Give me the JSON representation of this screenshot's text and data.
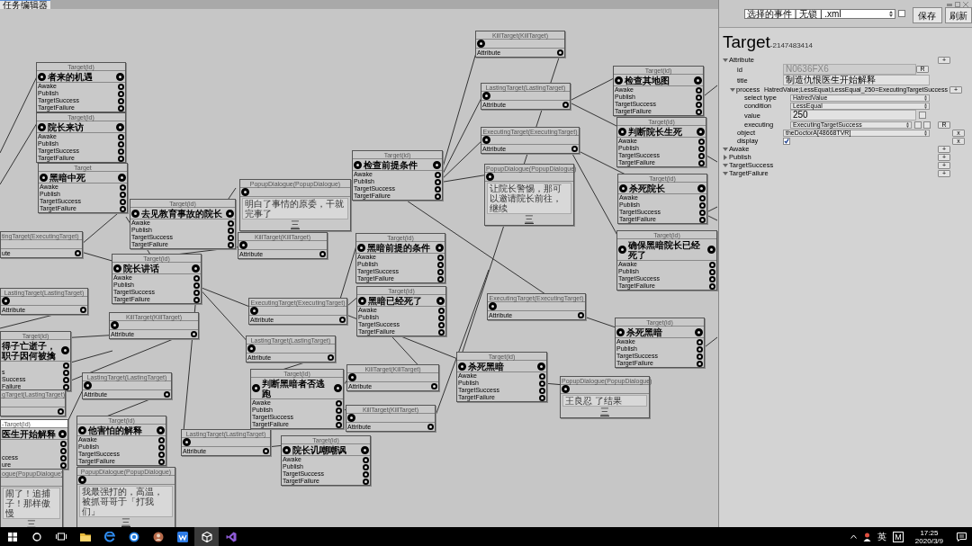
{
  "window": {
    "tab": "任务编辑器"
  },
  "nodes": [
    {
      "kind": "target",
      "header": "Target(id)",
      "title": "者来的机遇",
      "rows": [
        "Awake",
        "Publish",
        "TargetSuccess",
        "TargetFailure"
      ],
      "selected": false
    },
    {
      "kind": "target",
      "header": "Target(id)",
      "title": "院长来访",
      "rows": [
        "Awake",
        "Publish",
        "TargetSuccess",
        "TargetFailure"
      ],
      "selected": false
    },
    {
      "kind": "target",
      "header": "Target",
      "title": "黑暗中死",
      "rows": [
        "Awake",
        "Publish",
        "TargetSuccess",
        "TargetFailure"
      ],
      "selected": false
    },
    {
      "kind": "target",
      "header": "Target(id)",
      "title": "去见教育事故的院长",
      "rows": [
        "Awake",
        "Publish",
        "TargetSuccess",
        "TargetFailure"
      ],
      "selected": false
    },
    {
      "kind": "popup",
      "header": "PopupDialogue(PopupDialogue)",
      "text": "明白了事情的原委，干就完事了",
      "button": "三",
      "selected": false
    },
    {
      "kind": "single",
      "header": "tingTarget(ExecutingTarget)",
      "label": "ute",
      "selected": false
    },
    {
      "kind": "single",
      "header": "KillTarget(KillTarget)",
      "label": "Attribute",
      "selected": false
    },
    {
      "kind": "target",
      "header": "Target(id)",
      "title": "院长讲话",
      "rows": [
        "Awake",
        "Publish",
        "TargetSuccess",
        "TargetFailure"
      ],
      "selected": false
    },
    {
      "kind": "single",
      "header": "LastingTarget(LastingTarget)",
      "label": "Attribute",
      "selected": false
    },
    {
      "kind": "single",
      "header": "KillTarget(KillTarget)",
      "label": "Attribute",
      "selected": false
    },
    {
      "kind": "target",
      "header": "Target(id)",
      "title": "得子亡逝子，职子因何被擒",
      "rows": [
        "s",
        "Success",
        "Failure"
      ],
      "selected": false
    },
    {
      "kind": "single",
      "header": "gTarget(LastingTarget)",
      "selected": false
    },
    {
      "kind": "target",
      "header": "-Target(id)",
      "title": "医生开始解释",
      "rows": [
        "ccess",
        "ure"
      ],
      "selected": true
    },
    {
      "kind": "popup",
      "header": "ogue(PopupDialogue)",
      "text": "闹了！追捕子！那样傲慢",
      "button": "三",
      "selected": false
    },
    {
      "kind": "single",
      "header": "LastingTarget(LastingTarget)",
      "label": "Attribute",
      "selected": false
    },
    {
      "kind": "target",
      "header": "Target(id)",
      "title": "他害怕的解释",
      "rows": [
        "Awake",
        "Publish",
        "TargetSuccess",
        "TargetFailure"
      ],
      "selected": false
    },
    {
      "kind": "popup",
      "header": "PopupDialogue(PopupDialogue)",
      "text": "我最强打的，高温，被抓哥哥于「打我们」",
      "button": "三",
      "selected": false
    },
    {
      "kind": "single",
      "header": "LastingTarget(LastingTarget)",
      "label": "Attribute",
      "selected": false
    },
    {
      "kind": "single",
      "header": "ExecutingTarget(ExecutingTarget)",
      "label": "Attribute",
      "selected": false
    },
    {
      "kind": "single",
      "header": "LastingTarget(LastingTarget)",
      "label": "Attribute",
      "selected": false
    },
    {
      "kind": "target",
      "header": "Target(id)",
      "title": "判断黑暗者否逃跑",
      "rows": [
        "Awake",
        "Publish",
        "TargetSuccess",
        "TargetFailure"
      ],
      "selected": false
    },
    {
      "kind": "single",
      "header": "KillTarget(KillTarget)",
      "label": "Attribute",
      "selected": false
    },
    {
      "kind": "single",
      "header": "KillTarget(KillTarget)",
      "label": "Attribute",
      "selected": false
    },
    {
      "kind": "target",
      "header": "Target(id)",
      "title": "院长讥嘲嘲讽",
      "rows": [
        "Awake",
        "Publish",
        "TargetSuccess",
        "TargetFailure"
      ],
      "selected": false
    },
    {
      "kind": "target",
      "header": "Target(id)",
      "title": "检查前提条件",
      "rows": [
        "Awake",
        "Publish",
        "TargetSuccess",
        "TargetFailure"
      ],
      "selected": false
    },
    {
      "kind": "target",
      "header": "Target(id)",
      "title": "黑暗前提的条件",
      "rows": [
        "Awake",
        "Publish",
        "TargetSuccess",
        "TargetFailure"
      ],
      "selected": false
    },
    {
      "kind": "target",
      "header": "Target(id)",
      "title": "黑暗已经死了",
      "rows": [
        "Awake",
        "Publish",
        "TargetSuccess",
        "TargetFailure"
      ],
      "selected": false
    },
    {
      "kind": "single",
      "header": "KillTarget(KillTarget)",
      "label": "Attribute",
      "selected": false
    },
    {
      "kind": "single",
      "header": "LastingTarget(LastingTarget)",
      "label": "Attribute",
      "selected": false
    },
    {
      "kind": "single",
      "header": "ExecutingTarget(ExecutingTarget)",
      "label": "Attribute",
      "selected": false
    },
    {
      "kind": "popup",
      "header": "PopupDialogue(PopupDialogue)",
      "text": "让院长警惕，那可以邀请院长前往，继续",
      "button": "三",
      "selected": false
    },
    {
      "kind": "single",
      "header": "ExecutingTarget(ExecutingTarget)",
      "label": "Attribute",
      "selected": false
    },
    {
      "kind": "target",
      "header": "Target(id)",
      "title": "杀死黑暗",
      "rows": [
        "Awake",
        "Publish",
        "TargetSuccess",
        "TargetFailure"
      ],
      "selected": false
    },
    {
      "kind": "popup",
      "header": "PopupDialogue(PopupDialogue)",
      "text": "王良忍 了结果",
      "button": "三",
      "selected": false
    },
    {
      "kind": "target",
      "header": "Target(id)",
      "title": "检查其地图",
      "rows": [
        "Awake",
        "Publish",
        "TargetSuccess",
        "TargetFailure"
      ],
      "selected": false
    },
    {
      "kind": "target",
      "header": "Target(id)",
      "title": "判断院长生死",
      "rows": [
        "Awake",
        "Publish",
        "TargetSuccess",
        "TargetFailure"
      ],
      "selected": false
    },
    {
      "kind": "target",
      "header": "Target(id)",
      "title": "杀死院长",
      "rows": [
        "Awake",
        "Publish",
        "TargetSuccess",
        "TargetFailure"
      ],
      "selected": false
    },
    {
      "kind": "target",
      "header": "Target(id)",
      "title": "确保黑暗院长已经死了",
      "rows": [
        "Awake",
        "Publish",
        "TargetSuccess",
        "TargetFailure"
      ],
      "selected": false
    },
    {
      "kind": "target",
      "header": "Target(id)",
      "title": "杀死黑暗",
      "rows": [
        "Awake",
        "Publish",
        "TargetSuccess",
        "TargetFailure"
      ],
      "selected": false
    }
  ],
  "toolbar": {
    "file_dropdown": "选择的事件 | 无锁 | .xml",
    "checkbox": {
      "checked": false
    },
    "buttons": [
      "保存",
      "刷新"
    ]
  },
  "inspector": {
    "heading": "Target",
    "number": "-2147483414",
    "sections": [
      {
        "label": "Attribute",
        "expanded": true,
        "button": "+",
        "fields": [
          {
            "kind": "text",
            "label": "id",
            "value": "N0636FX6",
            "disabled": true,
            "button": "R"
          },
          {
            "kind": "text",
            "label": "title",
            "value": "制造仇恨医生开始解释",
            "disabled": false
          },
          {
            "kind": "group",
            "label": "process",
            "expanded": true,
            "value": "HatredValue;LessEqual;LessEqual_250=ExecutingTargetSuccess",
            "button": "+",
            "children": [
              {
                "kind": "dropdown",
                "label": "select type",
                "value": "HatredValue"
              },
              {
                "kind": "dropdown",
                "label": "condition",
                "value": "LessEqual"
              },
              {
                "kind": "text",
                "label": "value",
                "value": "250",
                "disabled": false,
                "checkboxes": [
                  {
                    "checked": false
                  }
                ]
              },
              {
                "kind": "dropdown",
                "label": "executing",
                "value": "ExecutingTargetSuccess",
                "checkboxes": [
                  {
                    "checked": false
                  },
                  {
                    "checked": false
                  }
                ],
                "button": "R"
              }
            ]
          },
          {
            "kind": "dropdown",
            "label": "object",
            "value": "theDoctorA[48668TVR]",
            "button": "x"
          },
          {
            "kind": "checkbox",
            "label": "display",
            "checked": true,
            "button": "x"
          }
        ]
      },
      {
        "label": "Awake",
        "expanded": true,
        "button": "+"
      },
      {
        "label": "Publish",
        "expanded": false,
        "button": "+"
      },
      {
        "label": "TargetSuccess",
        "expanded": true,
        "button": "+"
      },
      {
        "label": "TargetFailure",
        "expanded": true,
        "button": "+"
      }
    ]
  },
  "taskbar": {
    "apps": [
      {
        "kind": "folder",
        "selected": false
      },
      {
        "kind": "browser",
        "selected": false
      },
      {
        "kind": "ring",
        "selected": false
      },
      {
        "kind": "avatar",
        "selected": false
      },
      {
        "kind": "writer",
        "selected": false
      },
      {
        "kind": "unity",
        "selected": true
      },
      {
        "kind": "studio",
        "selected": false
      }
    ],
    "input_language": "英",
    "ime_mode": "M",
    "time": "17:25",
    "date": "2020/3/9"
  }
}
